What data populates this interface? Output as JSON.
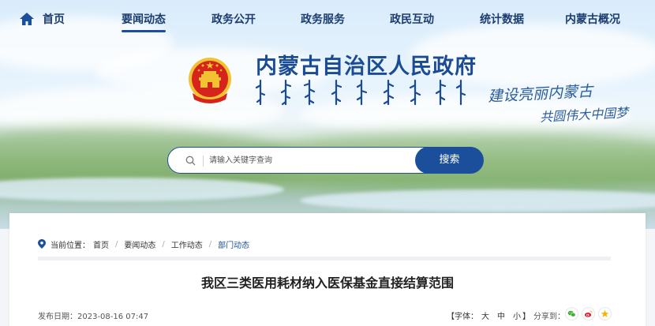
{
  "nav": {
    "items": [
      {
        "label": "首页"
      },
      {
        "label": "要闻动态"
      },
      {
        "label": "政务公开"
      },
      {
        "label": "政务服务"
      },
      {
        "label": "政民互动"
      },
      {
        "label": "统计数据"
      },
      {
        "label": "内蒙古概况"
      }
    ],
    "active_index": 1
  },
  "header": {
    "site_title": "内蒙古自治区人民政府",
    "slogan_line1": "建设亮丽内蒙古",
    "slogan_line2": "共圆伟大中国梦"
  },
  "search": {
    "placeholder": "请输入关键字查询",
    "value": "",
    "button_label": "搜索"
  },
  "breadcrumb": {
    "prefix": "当前位置：",
    "items": [
      "首页",
      "要闻动态",
      "工作动态",
      "部门动态"
    ]
  },
  "article": {
    "title": "我区三类医用耗材纳入医保基金直接结算范围",
    "publish_label": "发布日期：",
    "publish_date": "2023-08-16 07:47",
    "font_size_prefix": "【字体：",
    "font_large": "大",
    "font_medium": "中",
    "font_small": "小",
    "font_size_suffix": "】",
    "share_label": "分享到："
  },
  "icons": {
    "home": "home-icon",
    "emblem": "national-emblem-icon",
    "search": "search-icon",
    "location": "location-pin-icon",
    "wechat": "wechat-icon",
    "weibo": "weibo-icon",
    "qzone": "qzone-icon"
  },
  "colors": {
    "brand_blue": "#1b4f9c",
    "title_blue": "#1a4b95",
    "emblem_red": "#d6231b",
    "emblem_gold": "#f2c230",
    "wechat_green": "#3cb034",
    "weibo_red": "#e6162d",
    "qzone_yellow": "#f5b400"
  }
}
